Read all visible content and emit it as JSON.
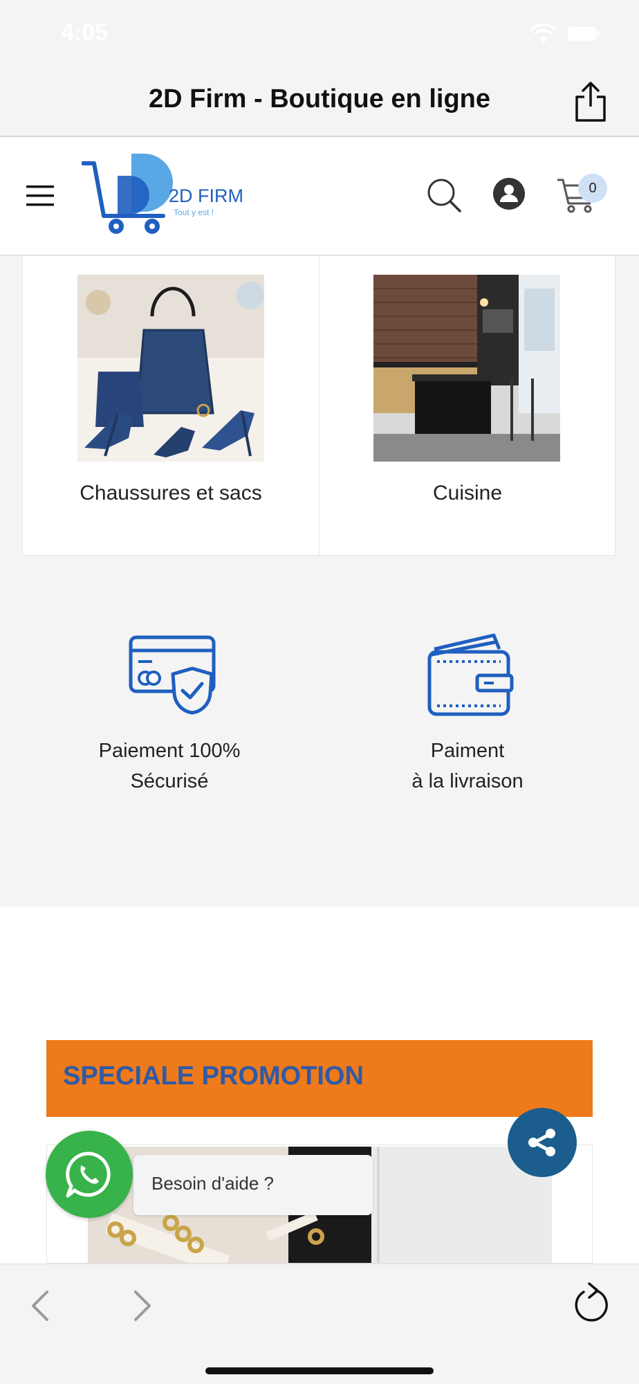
{
  "status": {
    "time": "4:05"
  },
  "titlebar": {
    "title": "2D Firm - Boutique en ligne"
  },
  "header": {
    "logo_text": "2D FIRM",
    "logo_tagline": "Tout y est !",
    "cart_count": "0"
  },
  "categories": [
    {
      "label": "Chaussures et sacs"
    },
    {
      "label": "Cuisine"
    }
  ],
  "features": [
    {
      "line1": "Paiement 100%",
      "line2": "Sécurisé"
    },
    {
      "line1": "Paiment",
      "line2": "à la livraison"
    }
  ],
  "promo": {
    "title": "SPECIALE PROMOTION"
  },
  "whatsapp": {
    "help_text": "Besoin d'aide ?"
  },
  "colors": {
    "brand_blue": "#1f5fbf",
    "promo_orange": "#ee7a1b",
    "promo_text": "#2f5aa6",
    "whatsapp_green": "#38b24a",
    "share_fab": "#1b5d8c"
  }
}
